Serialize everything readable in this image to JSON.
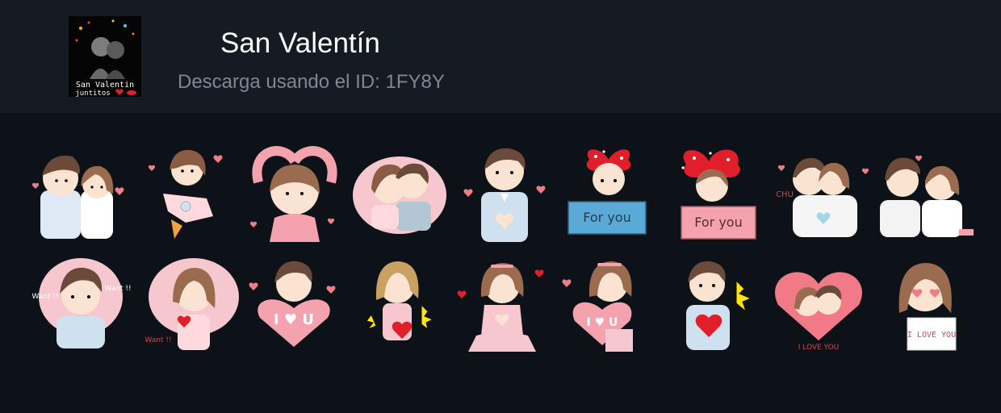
{
  "pack": {
    "title": "San Valentín",
    "download_text": "Descarga usando el ID: 1FY8Y",
    "thumbnail_caption_line1": "San Valentin",
    "thumbnail_caption_line2": "juntitos"
  },
  "stickers": [
    {
      "name": "couple-hug-sticker",
      "label": ""
    },
    {
      "name": "girl-rocket-sticker",
      "label": ""
    },
    {
      "name": "girl-heart-arms-sticker",
      "label": ""
    },
    {
      "name": "couple-cheek-sticker",
      "label": ""
    },
    {
      "name": "boy-heart-hands-sticker",
      "label": ""
    },
    {
      "name": "bow-girl-for-you-sticker",
      "label": "For you"
    },
    {
      "name": "bow-girl-for-you-pink-sticker",
      "label": "For you"
    },
    {
      "name": "couple-chu-sticker",
      "label": "CHU"
    },
    {
      "name": "couple-kiss-sticker",
      "label": ""
    },
    {
      "name": "boy-want-sticker",
      "label": "Want !!"
    },
    {
      "name": "girl-want-sticker",
      "label": "Want !!"
    },
    {
      "name": "boy-i-love-u-sticker",
      "label": "I ♥ U"
    },
    {
      "name": "blonde-girl-heart-sticker",
      "label": ""
    },
    {
      "name": "girl-heart-hands-sticker",
      "label": ""
    },
    {
      "name": "girl-i-love-u-sticker",
      "label": "I ♥ U"
    },
    {
      "name": "boy-holding-heart-sticker",
      "label": ""
    },
    {
      "name": "couple-big-heart-sticker",
      "label": "I LOVE YOU"
    },
    {
      "name": "girl-i-love-you-sign-sticker",
      "label": "I LOVE YOU"
    }
  ]
}
